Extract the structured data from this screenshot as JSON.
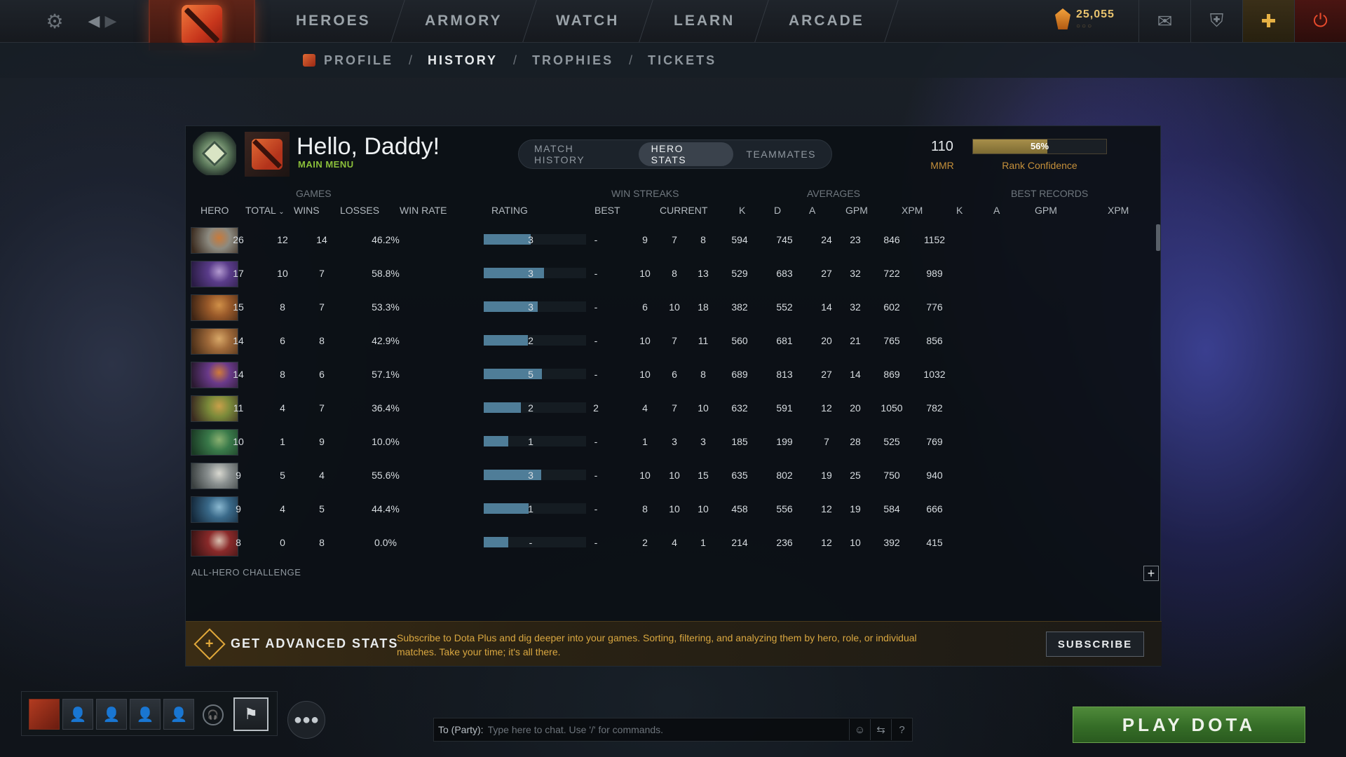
{
  "topbar": {
    "nav": [
      "HEROES",
      "ARMORY",
      "WATCH",
      "LEARN",
      "ARCADE"
    ],
    "shards": "25,055",
    "shard_dots": "○○○"
  },
  "subnav": {
    "items": [
      "PROFILE",
      "HISTORY",
      "TROPHIES",
      "TICKETS"
    ],
    "separator": "/",
    "active": "HISTORY"
  },
  "profile": {
    "greeting": "Hello, Daddy!",
    "subtitle": "MAIN MENU",
    "mmr": "110",
    "mmr_label": "MMR",
    "rank_confidence_pct": 56,
    "rank_confidence_text": "56%",
    "rank_confidence_label": "Rank Confidence"
  },
  "tabs": [
    "MATCH HISTORY",
    "HERO STATS",
    "TEAMMATES"
  ],
  "active_tab": "HERO STATS",
  "table": {
    "groups": {
      "games": "GAMES",
      "win_streaks": "WIN STREAKS",
      "averages": "AVERAGES",
      "best_records": "BEST RECORDS"
    },
    "headers": {
      "hero": "HERO",
      "total": "TOTAL",
      "wins": "WINS",
      "losses": "LOSSES",
      "winrate": "WIN RATE",
      "rating": "RATING",
      "best": "BEST",
      "current": "CURRENT",
      "avg_k": "K",
      "avg_d": "D",
      "avg_a": "A",
      "avg_gpm": "GPM",
      "avg_xpm": "XPM",
      "best_k": "K",
      "best_a": "A",
      "best_gpm": "GPM",
      "best_xpm": "XPM"
    },
    "rows": [
      {
        "total": "26",
        "wins": "12",
        "losses": "14",
        "winrate": "46.2%",
        "rating": 0.46,
        "best": "3",
        "current": "-",
        "k": "9",
        "d": "7",
        "a": "8",
        "gpm": "594",
        "xpm": "745",
        "bk": "24",
        "ba": "23",
        "bgpm": "846",
        "bxpm": "1152",
        "hero_colors": [
          "#8c8a80",
          "#c97a3a",
          "#3a2a1e"
        ]
      },
      {
        "total": "17",
        "wins": "10",
        "losses": "7",
        "winrate": "58.8%",
        "rating": 0.59,
        "best": "3",
        "current": "-",
        "k": "10",
        "d": "8",
        "a": "13",
        "gpm": "529",
        "xpm": "683",
        "bk": "27",
        "ba": "32",
        "bgpm": "722",
        "bxpm": "989",
        "hero_colors": [
          "#5a3c8a",
          "#b39ad0",
          "#2a1c44"
        ]
      },
      {
        "total": "15",
        "wins": "8",
        "losses": "7",
        "winrate": "53.3%",
        "rating": 0.53,
        "best": "3",
        "current": "-",
        "k": "6",
        "d": "10",
        "a": "18",
        "gpm": "382",
        "xpm": "552",
        "bk": "14",
        "ba": "32",
        "bgpm": "602",
        "bxpm": "776",
        "hero_colors": [
          "#9a5a2a",
          "#d09048",
          "#3e2414"
        ]
      },
      {
        "total": "14",
        "wins": "6",
        "losses": "8",
        "winrate": "42.9%",
        "rating": 0.43,
        "best": "2",
        "current": "-",
        "k": "10",
        "d": "7",
        "a": "11",
        "gpm": "560",
        "xpm": "681",
        "bk": "20",
        "ba": "21",
        "bgpm": "765",
        "bxpm": "856",
        "hero_colors": [
          "#a06a3a",
          "#d8a868",
          "#4a2e18"
        ]
      },
      {
        "total": "14",
        "wins": "8",
        "losses": "6",
        "winrate": "57.1%",
        "rating": 0.57,
        "best": "5",
        "current": "-",
        "k": "10",
        "d": "6",
        "a": "8",
        "gpm": "689",
        "xpm": "813",
        "bk": "27",
        "ba": "14",
        "bgpm": "869",
        "bxpm": "1032",
        "hero_colors": [
          "#6a3a8a",
          "#d07a3a",
          "#2a1a30"
        ]
      },
      {
        "total": "11",
        "wins": "4",
        "losses": "7",
        "winrate": "36.4%",
        "rating": 0.36,
        "best": "2",
        "current": "2",
        "k": "4",
        "d": "7",
        "a": "10",
        "gpm": "632",
        "xpm": "591",
        "bk": "12",
        "ba": "20",
        "bgpm": "1050",
        "bxpm": "782",
        "hero_colors": [
          "#7a8a3a",
          "#c9a04a",
          "#3a2a20"
        ]
      },
      {
        "total": "10",
        "wins": "1",
        "losses": "9",
        "winrate": "10.0%",
        "rating": 0.1,
        "best": "1",
        "current": "-",
        "k": "1",
        "d": "3",
        "a": "3",
        "gpm": "185",
        "xpm": "199",
        "bk": "7",
        "ba": "28",
        "bgpm": "525",
        "bxpm": "769",
        "hero_colors": [
          "#3a7a4a",
          "#8ab070",
          "#1a3a24"
        ]
      },
      {
        "total": "9",
        "wins": "5",
        "losses": "4",
        "winrate": "55.6%",
        "rating": 0.56,
        "best": "3",
        "current": "-",
        "k": "10",
        "d": "10",
        "a": "15",
        "gpm": "635",
        "xpm": "802",
        "bk": "19",
        "ba": "25",
        "bgpm": "750",
        "bxpm": "940",
        "hero_colors": [
          "#8a9090",
          "#d8d8d0",
          "#3a4040"
        ]
      },
      {
        "total": "9",
        "wins": "4",
        "losses": "5",
        "winrate": "44.4%",
        "rating": 0.44,
        "best": "1",
        "current": "-",
        "k": "8",
        "d": "10",
        "a": "10",
        "gpm": "458",
        "xpm": "556",
        "bk": "12",
        "ba": "19",
        "bgpm": "584",
        "bxpm": "666",
        "hero_colors": [
          "#3a6a8a",
          "#8ab8d0",
          "#14283a"
        ]
      },
      {
        "total": "8",
        "wins": "0",
        "losses": "8",
        "winrate": "0.0%",
        "rating": 0.0,
        "best": "-",
        "current": "-",
        "k": "2",
        "d": "4",
        "a": "1",
        "gpm": "214",
        "xpm": "236",
        "bk": "12",
        "ba": "10",
        "bgpm": "392",
        "bxpm": "415",
        "hero_colors": [
          "#8a2a2a",
          "#d8c0b0",
          "#3a1414"
        ]
      }
    ]
  },
  "challenge_label": "ALL-HERO CHALLENGE",
  "banner": {
    "title": "GET ADVANCED STATS",
    "text": "Subscribe to Dota Plus and dig deeper into your games. Sorting, filtering, and analyzing them by hero, role, or individual matches. Take your time; it's all there.",
    "button": "SUBSCRIBE"
  },
  "chat": {
    "target": "To (Party):",
    "placeholder": "Type here to chat. Use '/' for commands."
  },
  "play_button": "PLAY DOTA",
  "colors": {
    "accent_gold": "#c48f3a",
    "plus_green": "#8bbf3a",
    "rating_bar": "#4f7d98",
    "play_green": "#356d27"
  }
}
